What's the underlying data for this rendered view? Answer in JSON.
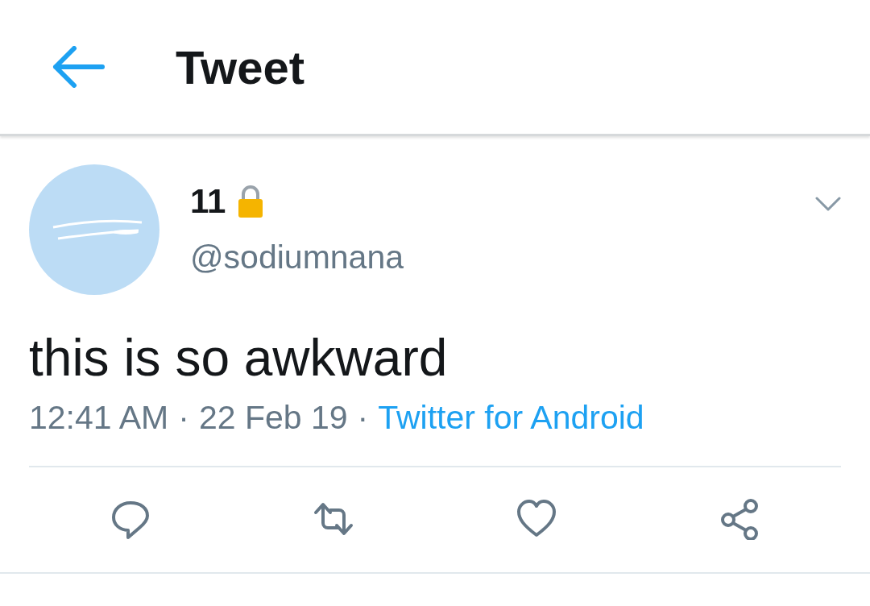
{
  "header": {
    "title": "Tweet"
  },
  "tweet": {
    "name": "11",
    "protected": true,
    "handle": "@sodiumnana",
    "text": "this is so awkward",
    "meta": [
      {
        "kind": "time",
        "text": "12:41 AM"
      },
      {
        "kind": "separator",
        "text": "·"
      },
      {
        "kind": "date",
        "text": "22 Feb 19"
      },
      {
        "kind": "separator",
        "text": "·"
      },
      {
        "kind": "source",
        "text": "Twitter for Android"
      }
    ],
    "actions": [
      {
        "kind": "reply"
      },
      {
        "kind": "retweet"
      },
      {
        "kind": "like"
      },
      {
        "kind": "share"
      }
    ]
  }
}
